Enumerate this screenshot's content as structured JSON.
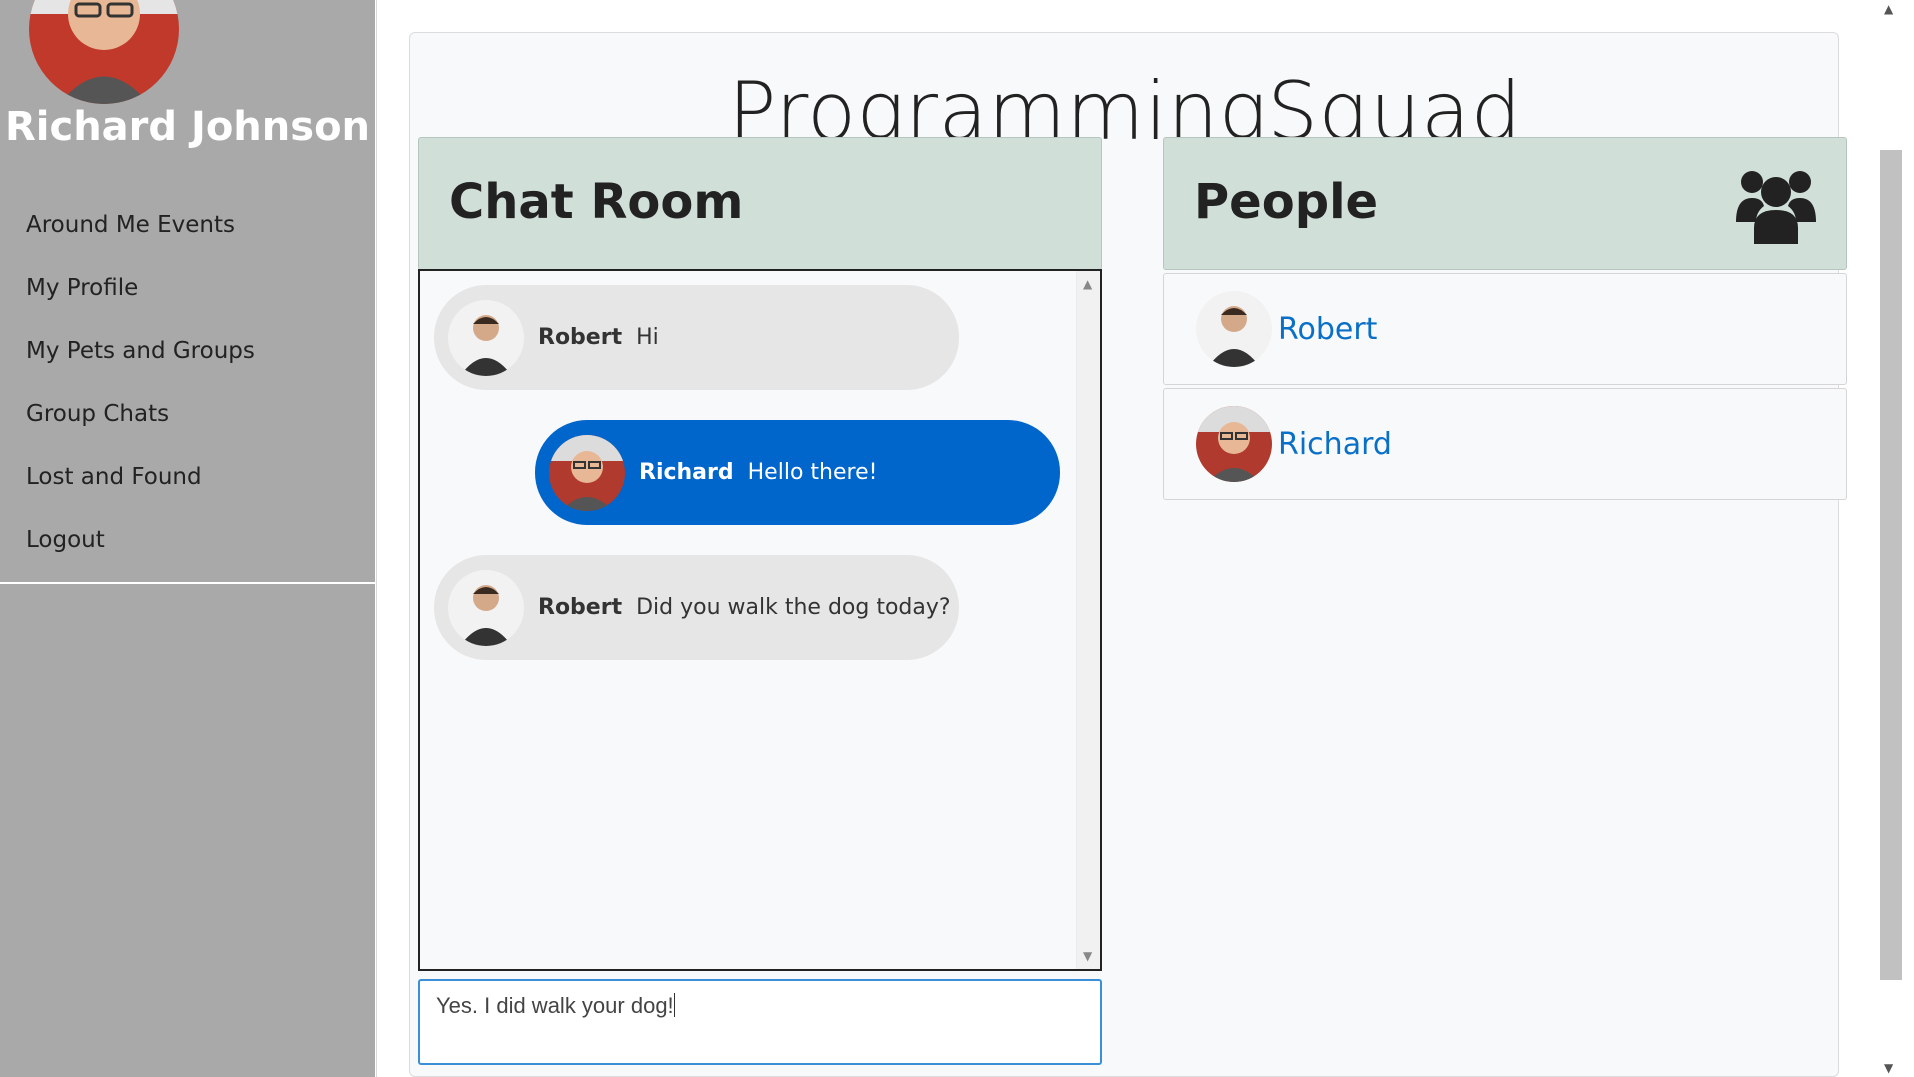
{
  "sidebar": {
    "user_name": "Richard Johnson",
    "items": [
      {
        "label": "Around Me Events"
      },
      {
        "label": "My Profile"
      },
      {
        "label": "My Pets and Groups"
      },
      {
        "label": "Group Chats"
      },
      {
        "label": "Lost and Found"
      },
      {
        "label": "Logout"
      }
    ]
  },
  "brand": "ProgrammingSquad",
  "chat": {
    "title": "Chat Room",
    "messages": [
      {
        "sender": "Robert",
        "text": "Hi",
        "mine": false
      },
      {
        "sender": "Richard",
        "text": "Hello there!",
        "mine": true
      },
      {
        "sender": "Robert",
        "text": "Did you walk the dog today?",
        "mine": false
      }
    ],
    "input_value": "Yes. I did walk your dog!"
  },
  "people": {
    "title": "People",
    "list": [
      {
        "name": "Robert"
      },
      {
        "name": "Richard"
      }
    ]
  },
  "colors": {
    "sidebar_bg": "#a9a9a9",
    "panel_header_bg": "#d1dfd9",
    "self_bubble": "#0066cc",
    "other_bubble": "#e6e6e6",
    "link": "#0a70c7"
  }
}
